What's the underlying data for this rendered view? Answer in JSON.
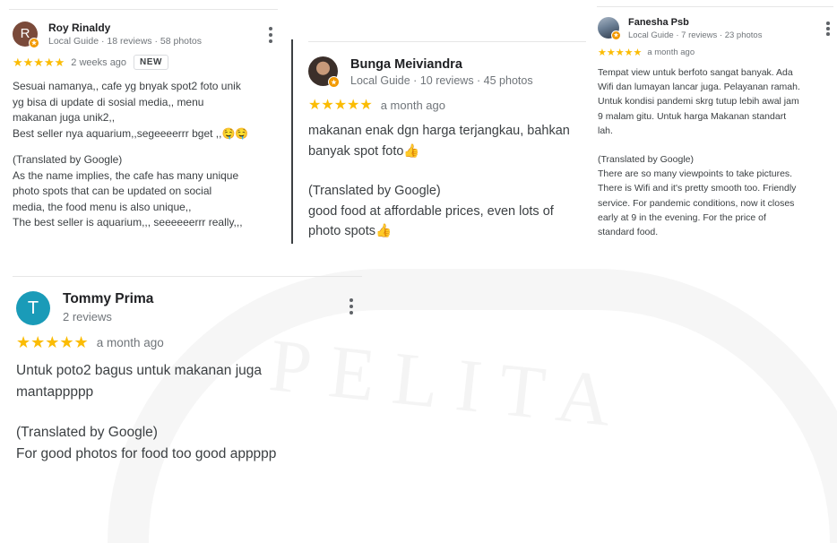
{
  "reviews": [
    {
      "avatar_letter": "R",
      "avatar_color": "#7a4a3a",
      "name": "Roy Rinaldy",
      "meta": "Local Guide · 18 reviews · 58 photos",
      "stars": "★★★★★",
      "rating": 5,
      "when": "2 weeks ago",
      "badge": "NEW",
      "original_lines": [
        "Sesuai namanya,, cafe yg bnyak spot2 foto unik",
        "yg bisa di update di sosial media,, menu",
        "makanan juga unik2,,",
        "Best seller nya aquarium,,segeeeerrr bget ,,🤤🤤"
      ],
      "translated_label": "(Translated by Google)",
      "translated_lines": [
        "As the name implies, the cafe has many unique",
        "photo spots that can be updated on social",
        "media, the food menu is also unique,,",
        "The best seller is aquarium,,, seeeeeerrr really,,,"
      ]
    },
    {
      "avatar_letter": "",
      "avatar_color": "#3b2f2a",
      "name": "Bunga Meiviandra",
      "meta": "Local Guide · 10 reviews · 45 photos",
      "stars": "★★★★★",
      "rating": 5,
      "when": "a month ago",
      "original_lines": [
        "makanan enak dgn harga terjangkau, bahkan",
        "banyak spot foto👍"
      ],
      "translated_label": "(Translated by Google)",
      "translated_lines": [
        "good food at affordable prices, even lots of",
        "photo spots👍"
      ]
    },
    {
      "avatar_letter": "",
      "avatar_color": "#6b7f95",
      "name": "Fanesha Psb",
      "meta": "Local Guide · 7 reviews · 23 photos",
      "stars": "★★★★★",
      "rating": 5,
      "when": "a month ago",
      "original_lines": [
        "Tempat view untuk berfoto sangat banyak. Ada",
        "Wifi dan lumayan lancar juga. Pelayanan ramah.",
        "Untuk kondisi pandemi skrg tutup lebih awal jam",
        "9 malam gitu. Untuk harga Makanan standart",
        "lah."
      ],
      "translated_label": "(Translated by Google)",
      "translated_lines": [
        "There are so many viewpoints to take pictures.",
        "There is Wifi and it's pretty smooth too. Friendly",
        "service. For pandemic conditions, now it closes",
        "early at 9 in the evening. For the price of",
        "standard food."
      ]
    },
    {
      "avatar_letter": "T",
      "avatar_color": "#1a9bb8",
      "name": "Tommy Prima",
      "meta": "2 reviews",
      "stars": "★★★★★",
      "rating": 5,
      "when": "a month ago",
      "original_lines": [
        "Untuk poto2 bagus untuk makanan juga",
        "mantappppp"
      ],
      "translated_label": "(Translated by Google)",
      "translated_lines": [
        "For good photos for food too good appppp"
      ]
    }
  ],
  "watermark": "PELITA"
}
